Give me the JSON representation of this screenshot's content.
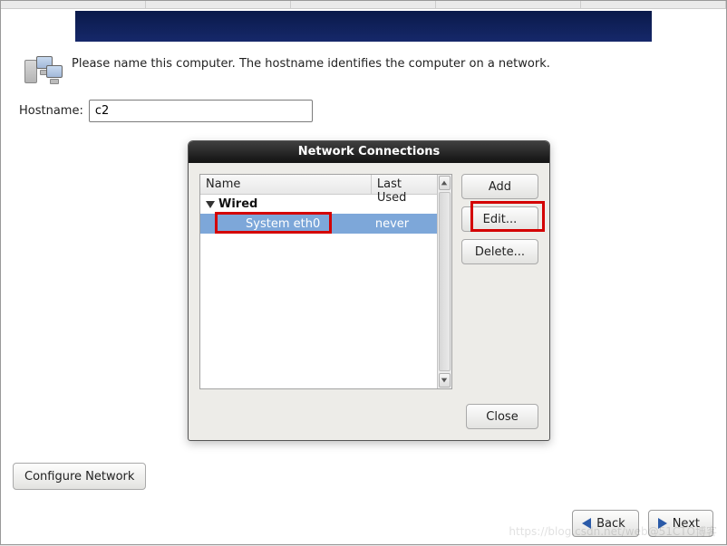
{
  "intro": {
    "text": "Please name this computer.  The hostname identifies the computer on a network."
  },
  "hostname": {
    "label": "Hostname:",
    "value": "c2"
  },
  "dialog": {
    "title": "Network Connections",
    "columns": {
      "name": "Name",
      "last_used": "Last Used"
    },
    "group": {
      "label": "Wired"
    },
    "rows": [
      {
        "name": "System eth0",
        "last_used": "never",
        "selected": true
      }
    ],
    "buttons": {
      "add": "Add",
      "edit": "Edit...",
      "delete": "Delete...",
      "close": "Close"
    }
  },
  "configure_button": "Configure Network",
  "nav": {
    "back": "Back",
    "next": "Next"
  },
  "watermark": "https://blog.csdn.net/web@51CTO博客"
}
